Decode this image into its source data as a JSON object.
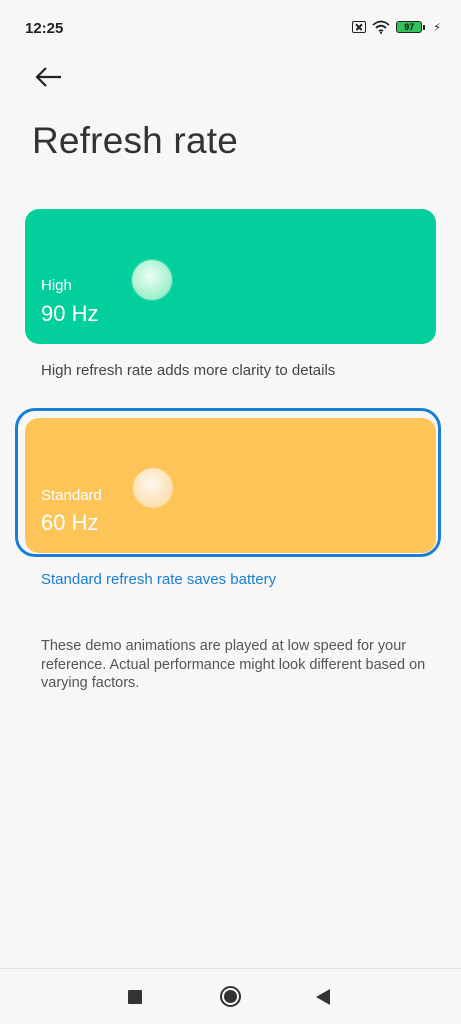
{
  "status_bar": {
    "time": "12:25",
    "battery_level": "97",
    "icons": [
      "sim-icon",
      "wifi-icon",
      "battery-icon",
      "charging-icon"
    ]
  },
  "header": {
    "back_icon": "arrow-left-icon",
    "title": "Refresh rate"
  },
  "options": {
    "high": {
      "label": "High",
      "value": "90 Hz",
      "caption": "High refresh rate adds more clarity to details",
      "color": "#02cf9c",
      "selected": false
    },
    "standard": {
      "label": "Standard",
      "value": "60 Hz",
      "caption": "Standard refresh rate saves battery",
      "color": "#fdc458",
      "selected": true
    }
  },
  "note": "These demo animations are played at low speed for your reference. Actual performance might look different based on varying factors.",
  "colors": {
    "accent": "#1a7fd4",
    "background": "#f7f7f7"
  },
  "nav_bar": {
    "icons": [
      "recents-square-icon",
      "home-circle-icon",
      "back-triangle-icon"
    ]
  }
}
